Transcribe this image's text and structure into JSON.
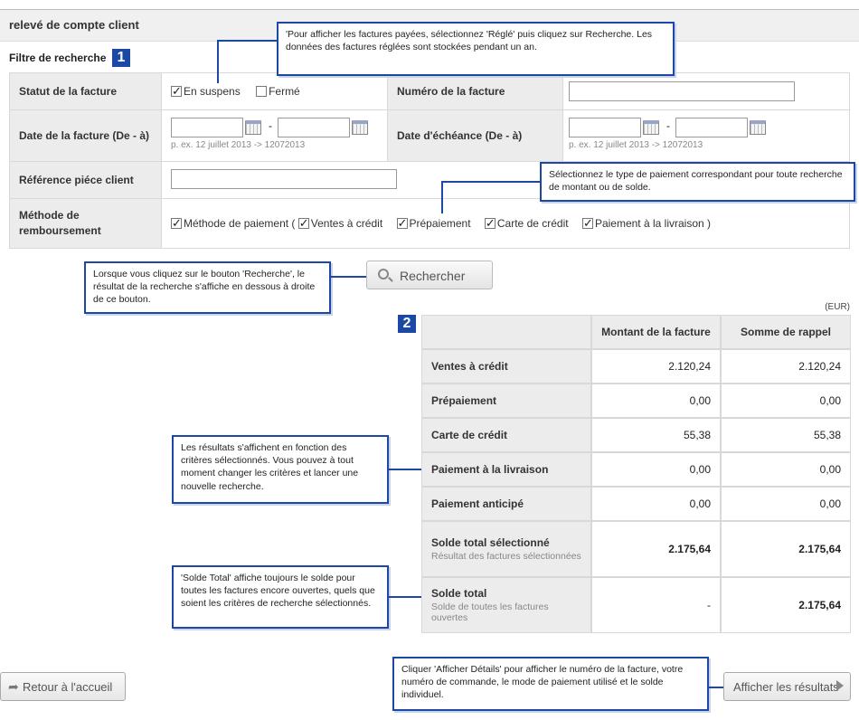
{
  "page": {
    "title": "relevé de compte client"
  },
  "filter": {
    "section_title": "Filtre de recherche",
    "badge": "1",
    "invoice_status": {
      "label": "Statut de la facture",
      "options": [
        {
          "label": "En suspens",
          "checked": true
        },
        {
          "label": "Fermé",
          "checked": false
        }
      ]
    },
    "invoice_number": {
      "label": "Numéro de la facture",
      "value": ""
    },
    "invoice_date": {
      "label": "Date de la facture (De - à)",
      "from": "",
      "to": "",
      "dash": "-",
      "hint": "p. ex. 12 juillet 2013 -> 12072013"
    },
    "due_date": {
      "label": "Date d'échéance (De - à)",
      "from": "",
      "to": "",
      "dash": "-",
      "hint": "p. ex. 12 juillet 2013 -> 12072013"
    },
    "customer_reference": {
      "label": "Référence piéce client",
      "value": ""
    },
    "refund_method": {
      "label_line1": "Méthode de",
      "label_line2": "remboursement",
      "options": [
        {
          "label": "Méthode de paiement (",
          "checked": true
        },
        {
          "label": "Ventes à crédit",
          "checked": true
        },
        {
          "label": "Prépaiement",
          "checked": true
        },
        {
          "label": "Carte de crédit",
          "checked": true
        },
        {
          "label": "Paiement à la livraison )",
          "checked": true
        }
      ]
    }
  },
  "search_button": {
    "label": "Rechercher",
    "icon": "magnifier-icon"
  },
  "results": {
    "badge": "2",
    "currency": "(EUR)",
    "columns": [
      "",
      "Montant de la facture",
      "Somme de rappel"
    ],
    "rows": [
      {
        "label": "Ventes à crédit",
        "sub": "",
        "amount": "2.120,24",
        "reminder": "2.120,24",
        "bold": false
      },
      {
        "label": "Prépaiement",
        "sub": "",
        "amount": "0,00",
        "reminder": "0,00",
        "bold": false
      },
      {
        "label": "Carte de crédit",
        "sub": "",
        "amount": "55,38",
        "reminder": "55,38",
        "bold": false
      },
      {
        "label": "Paiement à la livraison",
        "sub": "",
        "amount": "0,00",
        "reminder": "0,00",
        "bold": false
      },
      {
        "label": "Paiement anticipé",
        "sub": "",
        "amount": "0,00",
        "reminder": "0,00",
        "bold": false
      },
      {
        "label": "Solde total sélectionné",
        "sub": "Résultat des factures sélectionnées",
        "amount": "2.175,64",
        "reminder": "2.175,64",
        "bold": true
      },
      {
        "label": "Solde total",
        "sub": "Solde de toutes les factures ouvertes",
        "amount": "-",
        "reminder": "2.175,64",
        "bold": true
      }
    ]
  },
  "callouts": {
    "status_tip": "'Pour afficher les factures payées, sélectionnez 'Réglé' puis cliquez sur Recherche. Les données des factures réglées sont stockées pendant un an.",
    "payment_tip": "Sélectionnez le type de paiement correspondant pour toute recherche de montant ou de solde.",
    "search_tip": "Lorsque vous cliquez sur le bouton 'Recherche', le résultat de la recherche s'affiche en dessous à droite de ce bouton.",
    "results_tip": "Les résultats s'affichent en fonction des critères sélectionnés. Vous pouvez à tout moment changer les critères et lancer une nouvelle recherche.",
    "total_tip": "'Solde Total' affiche toujours le solde pour toutes les factures encore ouvertes, quels que soient les critères de recherche sélectionnés.",
    "details_tip": "Cliquer 'Afficher Détails' pour afficher le numéro de la facture, votre numéro de commande, le mode de paiement utilisé et le solde individuel."
  },
  "footer": {
    "back_label": "Retour à l'accueil",
    "back_icon": "return-arrow-icon",
    "show_results_label": "Afficher les résultats",
    "show_results_icon": "triangle-right-icon"
  },
  "colors": {
    "accent": "#1a48a4",
    "header_bg": "#ececec",
    "border": "#d8d8d8"
  }
}
